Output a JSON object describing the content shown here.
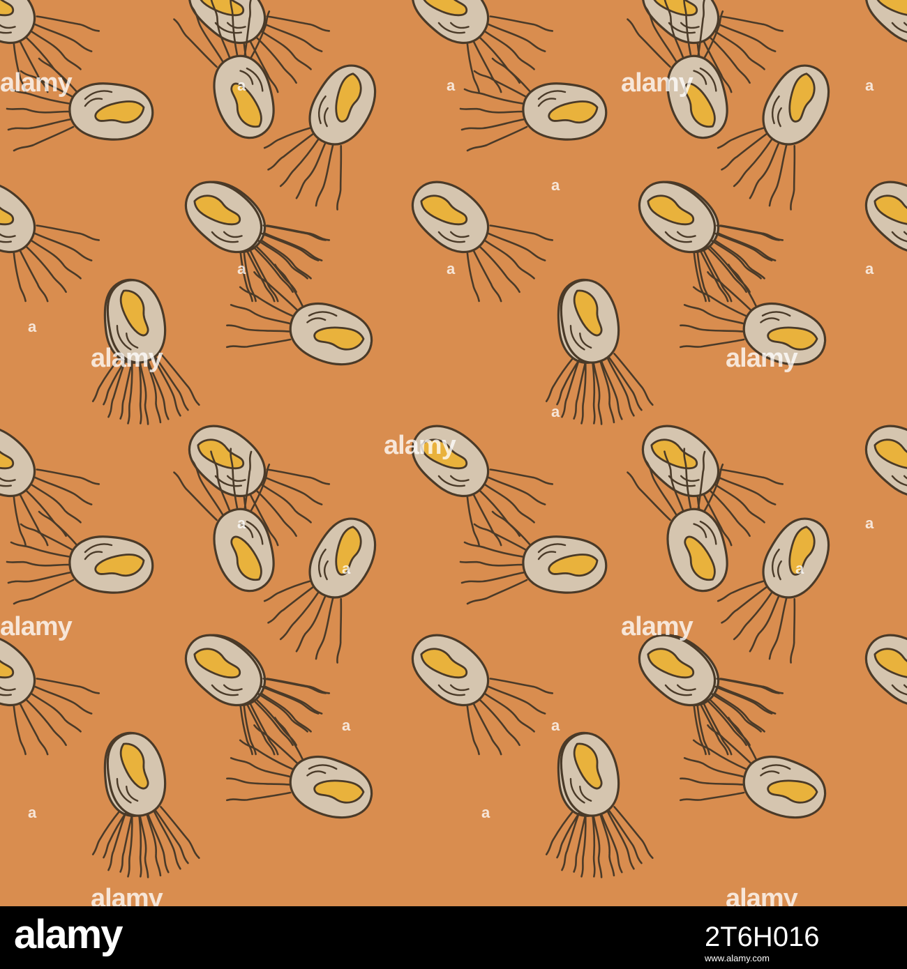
{
  "image": {
    "description": "Seamless vector pattern of beige bacteria cells with yellow bean-shaped nuclei and dark wavy flagella on an orange background",
    "colors": {
      "background": "#d98d4f",
      "cell_fill": "#d5c5af",
      "nucleus_fill": "#e9b23c",
      "outline": "#4a3a28",
      "footer_background": "#000000",
      "footer_text": "#ffffff"
    },
    "icons": [
      "bacterium-icon"
    ]
  },
  "watermark": {
    "word": "alamy",
    "mark": "a"
  },
  "footer": {
    "brand": "alamy",
    "image_id": "2T6H016",
    "subtitle": "www.alamy.com"
  }
}
